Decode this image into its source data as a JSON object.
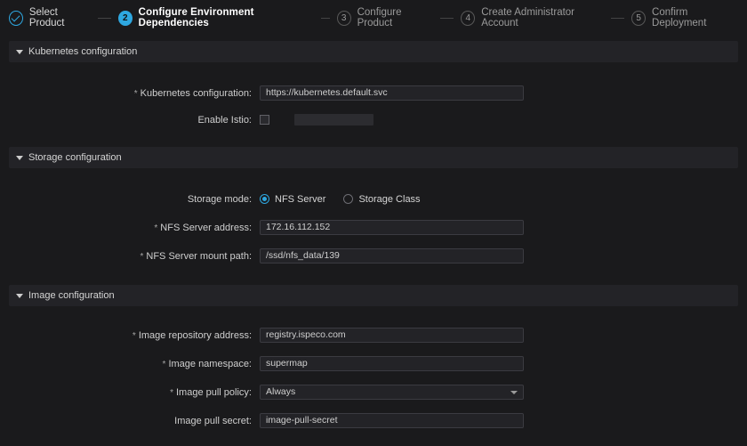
{
  "stepper": {
    "steps": [
      {
        "label": "Select Product",
        "state": "done"
      },
      {
        "num": "2",
        "label": "Configure Environment Dependencies",
        "state": "active"
      },
      {
        "num": "3",
        "label": "Configure Product",
        "state": "pending"
      },
      {
        "num": "4",
        "label": "Create Administrator Account",
        "state": "pending"
      },
      {
        "num": "5",
        "label": "Confirm Deployment",
        "state": "pending"
      }
    ]
  },
  "sections": {
    "kube": {
      "title": "Kubernetes configuration",
      "k8s_config_label": "Kubernetes configuration:",
      "k8s_config_value": "https://kubernetes.default.svc",
      "istio_label": "Enable Istio:"
    },
    "storage": {
      "title": "Storage configuration",
      "mode_label": "Storage mode:",
      "mode_nfs": "NFS Server",
      "mode_sc": "Storage Class",
      "nfs_addr_label": "NFS Server address:",
      "nfs_addr_value": "172.16.112.152",
      "nfs_path_label": "NFS Server mount path:",
      "nfs_path_value": "/ssd/nfs_data/139"
    },
    "image": {
      "title": "Image configuration",
      "repo_label": "Image repository address:",
      "repo_value": "registry.ispeco.com",
      "ns_label": "Image namespace:",
      "ns_value": "supermap",
      "policy_label": "Image pull policy:",
      "policy_value": "Always",
      "secret_label": "Image pull secret:",
      "secret_value": "image-pull-secret"
    }
  }
}
